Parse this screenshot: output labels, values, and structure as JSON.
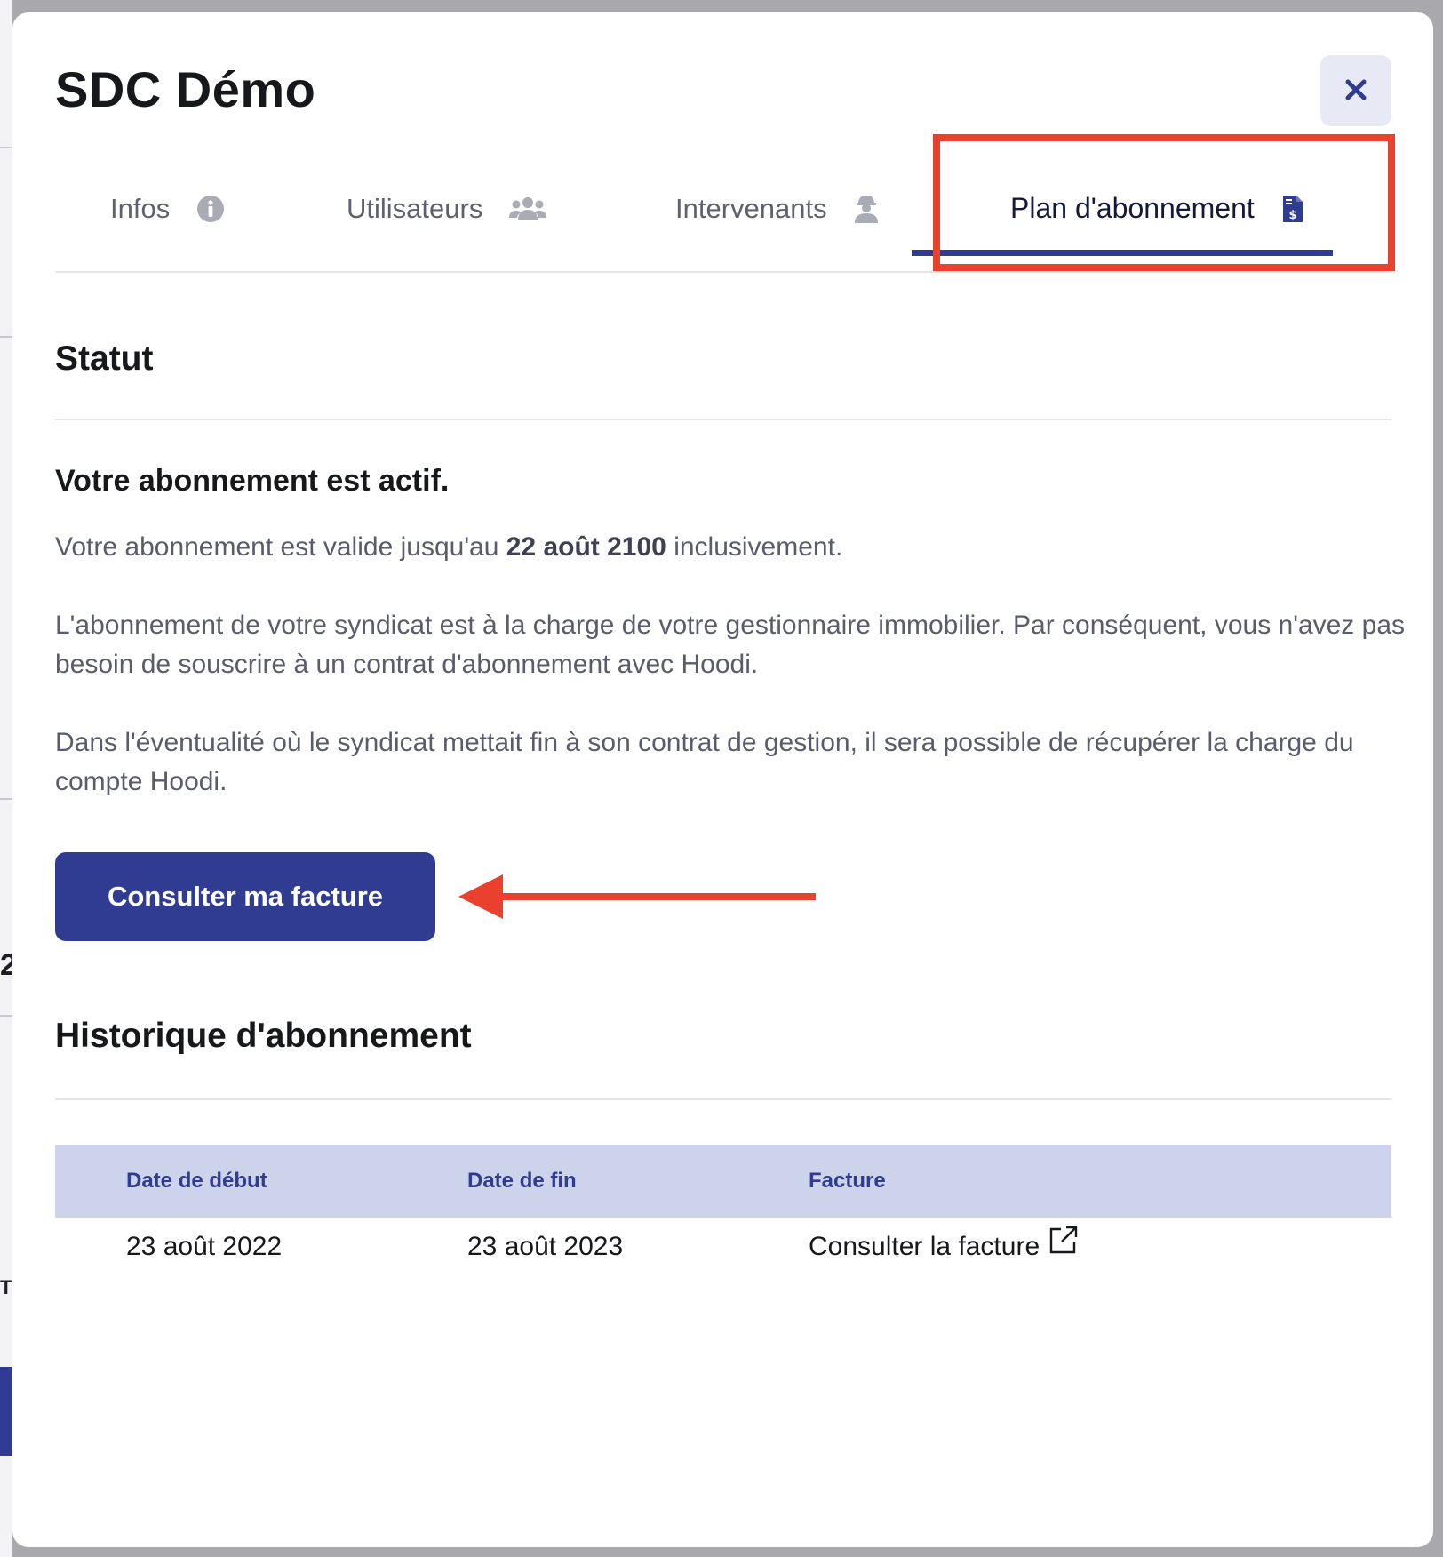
{
  "modal": {
    "title": "SDC Démo",
    "close_icon": "close-icon"
  },
  "tabs": [
    {
      "label": "Infos",
      "icon": "info-circle-icon",
      "active": false
    },
    {
      "label": "Utilisateurs",
      "icon": "users-group-icon",
      "active": false
    },
    {
      "label": "Intervenants",
      "icon": "worker-helmet-icon",
      "active": false
    },
    {
      "label": "Plan d'abonnement",
      "icon": "invoice-dollar-icon",
      "active": true
    }
  ],
  "statut": {
    "title": "Statut",
    "heading": "Votre abonnement est actif.",
    "validity_prefix": "Votre abonnement est valide jusqu'au ",
    "validity_date": "22 août 2100",
    "validity_suffix": " inclusivement.",
    "paragraph_2": "L'abonnement de votre syndicat est à la charge de votre gestionnaire immobilier. Par conséquent, vous n'avez pas besoin de souscrire à un contrat d'abonnement avec Hoodi.",
    "paragraph_3": "Dans l'éventualité où le syndicat mettait fin à son contrat de gestion, il sera possible de récupérer la charge du compte Hoodi.",
    "cta_label": "Consulter ma facture"
  },
  "history": {
    "title": "Historique d'abonnement",
    "columns": [
      "Date de début",
      "Date de fin",
      "Facture"
    ],
    "rows": [
      {
        "start": "23 août 2022",
        "end": "23 août 2023",
        "invoice_link": "Consulter la facture",
        "invoice_icon": "external-link-icon"
      }
    ]
  },
  "colors": {
    "primary": "#2f3c91",
    "annotation": "#e9412d",
    "header_row": "#cdd3eb",
    "body_text": "#5a5c6e"
  }
}
